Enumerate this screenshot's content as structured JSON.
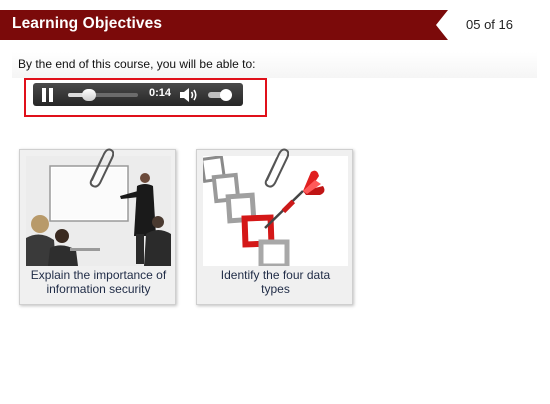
{
  "header": {
    "title": "Learning Objectives",
    "page_counter": "05 of 16",
    "bar_color": "#7b0a0a"
  },
  "intro": {
    "text": "By the end of this course, you will be able to:"
  },
  "audio_player": {
    "state": "playing",
    "time": "0:14",
    "progress": 0.3,
    "volume": 0.75,
    "highlight_color": "#e0101a"
  },
  "objectives": [
    {
      "caption": "Explain the importance of information security",
      "image": "presentation-meeting"
    },
    {
      "caption": "Identify the four data types",
      "image": "dart-in-target-squares"
    }
  ],
  "icons": {
    "pause": "pause-icon",
    "volume": "speaker-icon",
    "clip": "paperclip-icon"
  }
}
